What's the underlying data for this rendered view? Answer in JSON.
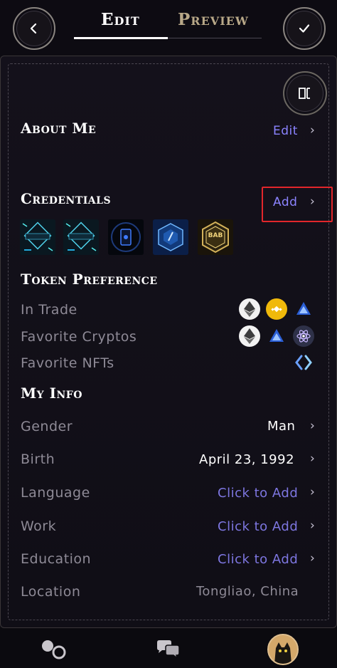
{
  "header": {
    "tabs": [
      {
        "label": "Edit"
      },
      {
        "label": "Preview"
      }
    ]
  },
  "about_me": {
    "title": "About Me",
    "edit_label": "Edit"
  },
  "credentials": {
    "title": "Credentials",
    "add_label": "Add",
    "badge_texts": [
      "BAB"
    ]
  },
  "token_preference": {
    "title": "Token Preference",
    "rows": [
      {
        "label": "In Trade",
        "icons": [
          "ethereum-icon",
          "bnb-icon",
          "arbitrum-icon"
        ]
      },
      {
        "label": "Favorite Cryptos",
        "icons": [
          "ethereum-icon",
          "arbitrum-icon",
          "cosmos-icon"
        ]
      },
      {
        "label": "Favorite NFTs",
        "icons": [
          "nft-collection-icon"
        ]
      }
    ]
  },
  "my_info": {
    "title": "My Info",
    "rows": [
      {
        "label": "Gender",
        "value": "Man"
      },
      {
        "label": "Birth",
        "value": "April 23, 1992"
      },
      {
        "label": "Language",
        "value": "Click to Add"
      },
      {
        "label": "Work",
        "value": "Click to Add"
      },
      {
        "label": "Education",
        "value": "Click to Add"
      },
      {
        "label": "Location",
        "value": "Tongliao, China"
      }
    ]
  },
  "colors": {
    "accent": "#8b83ff",
    "highlight": "#e2262b",
    "background": "#0d0b12"
  }
}
